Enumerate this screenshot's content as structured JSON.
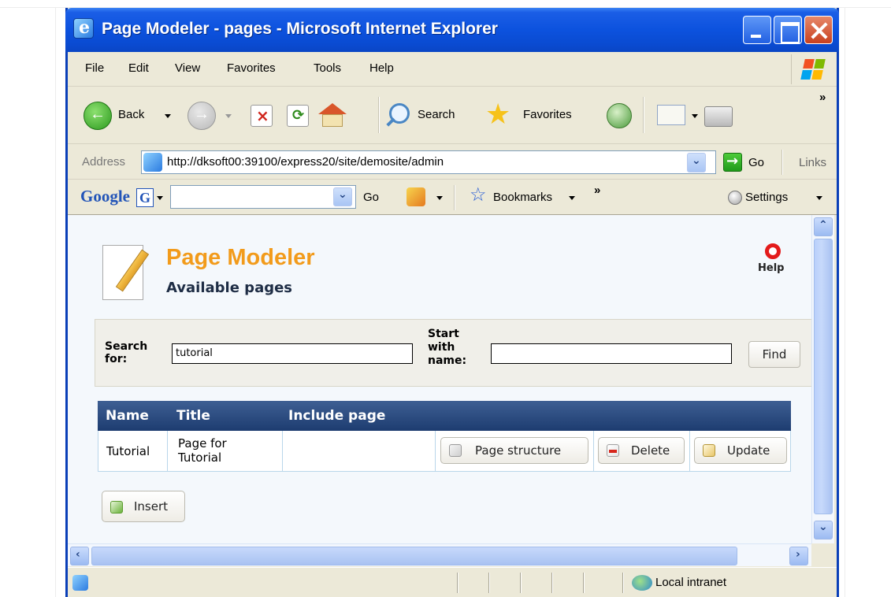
{
  "window": {
    "title": "Page Modeler - pages - Microsoft Internet Explorer"
  },
  "menu": [
    "File",
    "Edit",
    "View",
    "Favorites",
    "Tools",
    "Help"
  ],
  "toolbar": {
    "back_label": "Back",
    "search_label": "Search",
    "favorites_label": "Favorites",
    "chevron": "»"
  },
  "address": {
    "label": "Address",
    "url": "http://dksoft00:39100/express20/site/demosite/admin",
    "go_label": "Go",
    "links_label": "Links"
  },
  "google_bar": {
    "logo": "Google",
    "go_label": "Go",
    "bookmarks_label": "Bookmarks",
    "chevron": "»",
    "settings_label": "Settings"
  },
  "page": {
    "title": "Page Modeler",
    "subtitle": "Available pages",
    "help_label": "Help",
    "search": {
      "search_label_1": "Search",
      "search_label_2": "for:",
      "search_value": "tutorial",
      "start_label_1": "Start",
      "start_label_2": "with",
      "start_label_3": "name:",
      "start_value": "",
      "find_label": "Find"
    },
    "table": {
      "headers": [
        "Name",
        "Title",
        "Include page"
      ],
      "rows": [
        {
          "name": "Tutorial",
          "title_line1": "Page for",
          "title_line2": "Tutorial",
          "include_page": "",
          "structure_label": "Page structure",
          "delete_label": "Delete",
          "update_label": "Update"
        }
      ]
    },
    "insert_label": "Insert"
  },
  "status": {
    "zone": "Local intranet"
  },
  "colors": {
    "title_accent": "#f29b1b",
    "grid_header": "#1d3c70",
    "titlebar_blue": "#0c52de"
  }
}
